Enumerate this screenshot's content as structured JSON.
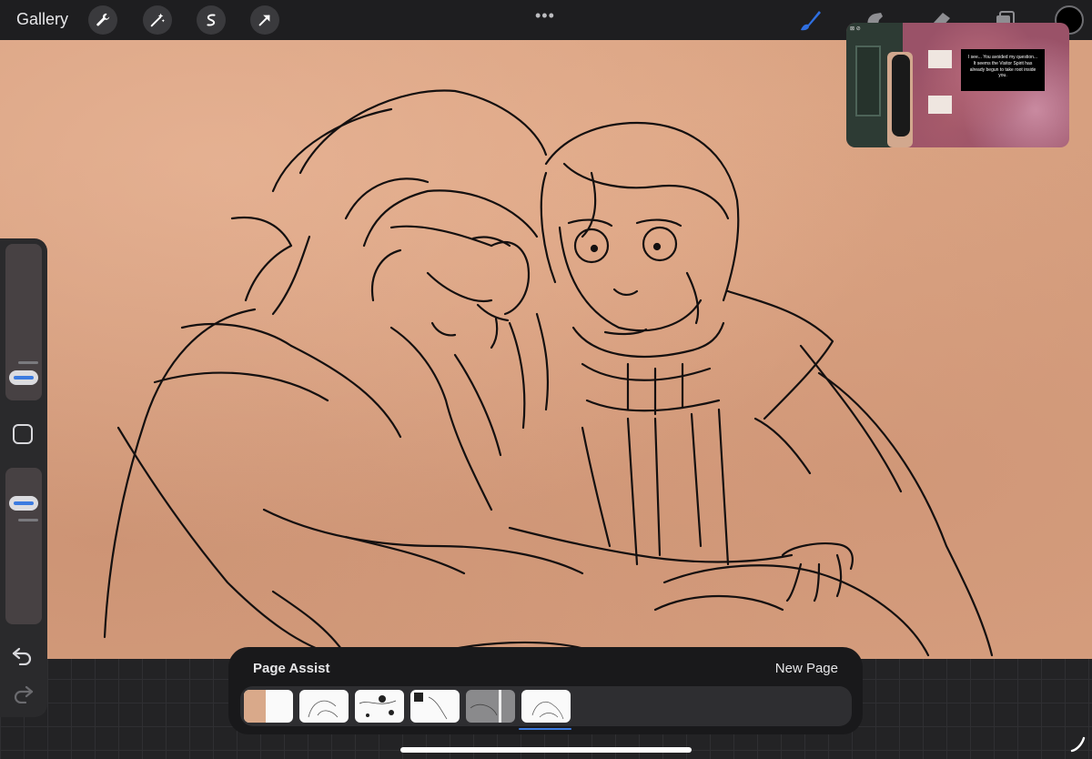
{
  "topbar": {
    "gallery_label": "Gallery",
    "tools_left": [
      "wrench-icon",
      "magic-wand-icon",
      "selection-icon",
      "transform-arrow-icon"
    ],
    "more_dots": "•••",
    "tools_right": [
      "brush-icon",
      "smudge-icon",
      "eraser-icon",
      "layers-icon"
    ],
    "current_color": "#000000",
    "active_tool_color": "#2f6fe0"
  },
  "pip": {
    "caption": "I see... You avoided my question... It seems the Visitor Spirit has already begun to take root inside you."
  },
  "page_assist": {
    "title": "Page Assist",
    "new_page_label": "New Page"
  },
  "sidebar": {
    "undo_icon": "undo-icon",
    "redo_icon": "redo-icon"
  },
  "colors": {
    "accent": "#3c7be0",
    "canvas": "#d7a080",
    "panel": "#19191b"
  }
}
